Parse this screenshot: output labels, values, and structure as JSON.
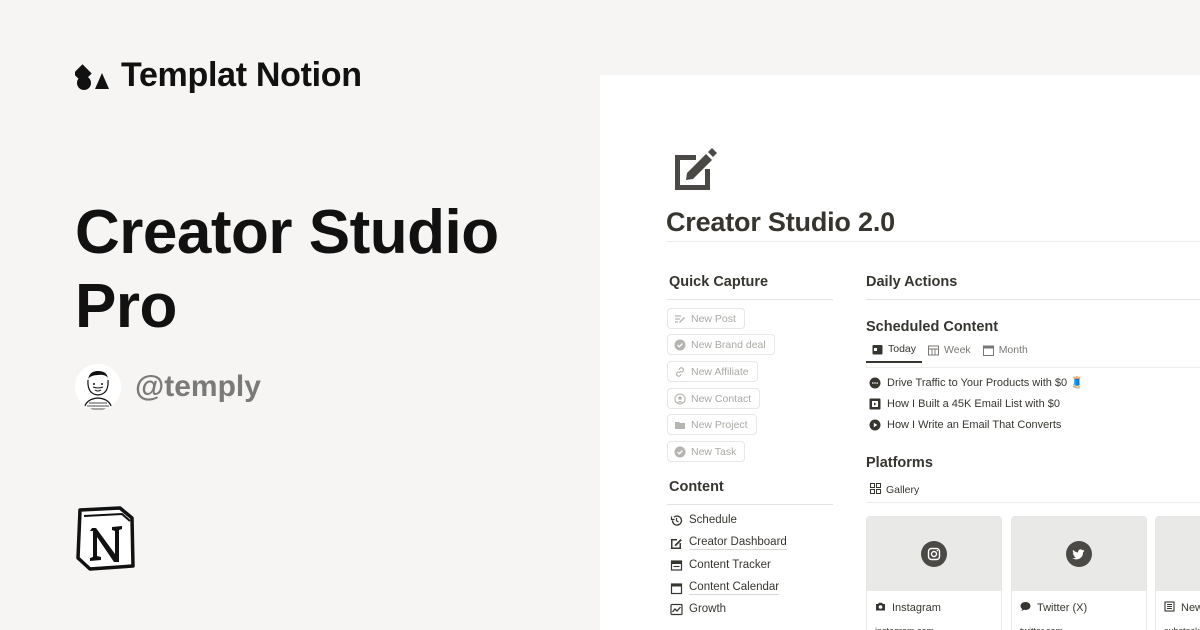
{
  "brand": {
    "name": "Templat Notion"
  },
  "hero": {
    "title_line1": "Creator Studio",
    "title_line2": "Pro"
  },
  "author": {
    "handle": "@temply"
  },
  "page": {
    "title": "Creator Studio 2.0",
    "quick_capture": {
      "heading": "Quick Capture",
      "buttons": [
        {
          "label": "New Post",
          "icon": "edit-lines-icon"
        },
        {
          "label": "New Brand deal",
          "icon": "check-badge-icon"
        },
        {
          "label": "New Affiliate",
          "icon": "link-icon"
        },
        {
          "label": "New Contact",
          "icon": "user-circle-icon"
        },
        {
          "label": "New Project",
          "icon": "folder-icon"
        },
        {
          "label": "New Task",
          "icon": "check-circle-icon"
        }
      ]
    },
    "content": {
      "heading": "Content",
      "items": [
        {
          "label": "Schedule",
          "icon": "history-icon"
        },
        {
          "label": "Creator Dashboard",
          "icon": "edit-icon"
        },
        {
          "label": "Content Tracker",
          "icon": "tracker-icon"
        },
        {
          "label": "Content Calendar",
          "icon": "calendar-icon"
        },
        {
          "label": "Growth",
          "icon": "growth-chart-icon"
        }
      ]
    },
    "daily_actions": {
      "heading": "Daily Actions"
    },
    "scheduled": {
      "heading": "Scheduled Content",
      "tabs": [
        {
          "label": "Today",
          "icon": "calendar-today-icon",
          "active": true
        },
        {
          "label": "Week",
          "icon": "table-icon",
          "active": false
        },
        {
          "label": "Month",
          "icon": "calendar-icon",
          "active": false
        }
      ],
      "items": [
        {
          "label": "Drive Traffic to Your Products with $0 🧵",
          "icon": "speech-bubble-icon"
        },
        {
          "label": "How I Built a 45K Email List with $0",
          "icon": "film-icon"
        },
        {
          "label": "How I Write an Email That Converts",
          "icon": "play-icon"
        }
      ]
    },
    "platforms": {
      "heading": "Platforms",
      "view": "Gallery",
      "cards": [
        {
          "name": "Instagram",
          "url": "instagram.com",
          "icon": "instagram-icon"
        },
        {
          "name": "Twitter (X)",
          "url": "twitter.com",
          "icon": "twitter-icon"
        },
        {
          "name": "New",
          "url": "substack",
          "icon": "newsletter-icon"
        }
      ]
    }
  }
}
